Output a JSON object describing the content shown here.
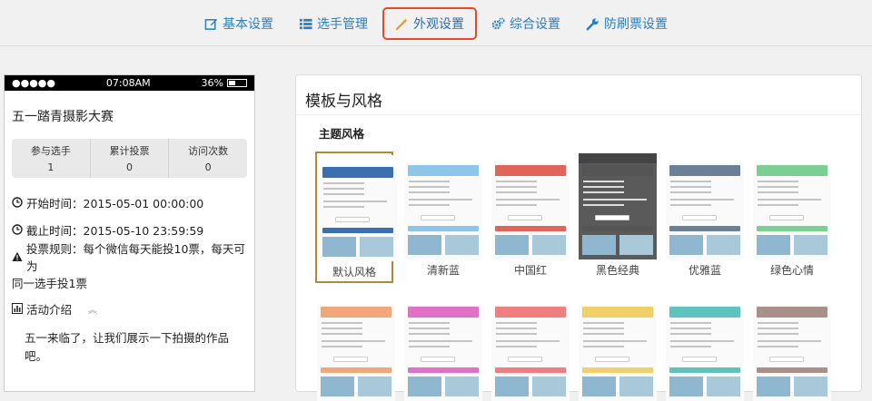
{
  "nav": {
    "items": [
      {
        "label": "基本设置",
        "icon": "edit-icon"
      },
      {
        "label": "选手管理",
        "icon": "list-icon"
      },
      {
        "label": "外观设置",
        "icon": "magic-wand-icon"
      },
      {
        "label": "综合设置",
        "icon": "gears-icon"
      },
      {
        "label": "防刷票设置",
        "icon": "wrench-icon"
      }
    ],
    "active_index": 2,
    "active_border_color": "#e34b2a",
    "link_color": "#2a7ec4"
  },
  "phone": {
    "status": {
      "signal": "●●●●●",
      "time": "07:08AM",
      "battery": "36%"
    },
    "title": "五一踏青摄影大赛",
    "stats": [
      {
        "label": "参与选手",
        "value": "1"
      },
      {
        "label": "累计投票",
        "value": "0"
      },
      {
        "label": "访问次数",
        "value": "0"
      }
    ],
    "start_time": "开始时间：2015-05-01 00:00:00",
    "end_time": "截止时间：2015-05-10 23:59:59",
    "rule_line1": "投票规则：每个微信每天能投10票，每天可为",
    "rule_line2": "同一选手投1票",
    "intro_heading": "活动介绍",
    "intro_text_line1": "五一来临了，让我们展示一下拍摄的作品",
    "intro_text_line2": "吧。"
  },
  "panel": {
    "title": "模板与风格",
    "subtitle": "主题风格",
    "themes": [
      {
        "label": "默认风格",
        "color": "#3b6fb0",
        "selected": true
      },
      {
        "label": "清新蓝",
        "color": "#8ec5e8",
        "selected": false
      },
      {
        "label": "中国红",
        "color": "#e0645a",
        "selected": false
      },
      {
        "label": "黑色经典",
        "color": "#555555",
        "selected": false
      },
      {
        "label": "优雅蓝",
        "color": "#6b7f99",
        "selected": false
      },
      {
        "label": "绿色心情",
        "color": "#7ccf93",
        "selected": false
      },
      {
        "label": "",
        "color": "#f2a77a",
        "selected": false
      },
      {
        "label": "",
        "color": "#e270c6",
        "selected": false
      },
      {
        "label": "",
        "color": "#ef7f7f",
        "selected": false
      },
      {
        "label": "",
        "color": "#f2d069",
        "selected": false
      },
      {
        "label": "",
        "color": "#5fc3bd",
        "selected": false
      },
      {
        "label": "",
        "color": "#a88f88",
        "selected": false
      }
    ],
    "selected_border_color": "#b0893a"
  }
}
